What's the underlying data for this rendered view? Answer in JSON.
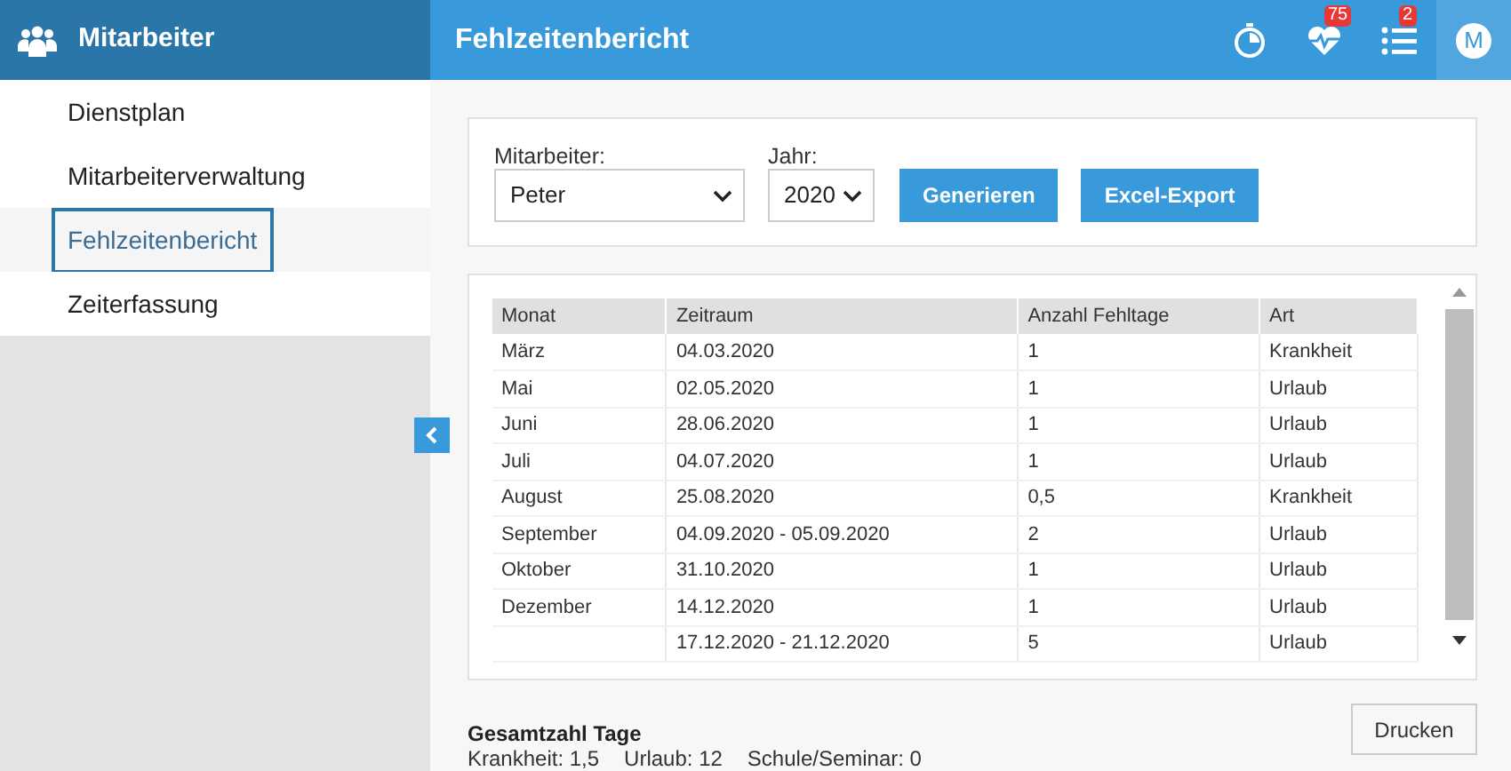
{
  "sidebar": {
    "title": "Mitarbeiter",
    "items": [
      {
        "label": "Dienstplan",
        "selected": false
      },
      {
        "label": "Mitarbeiterverwaltung",
        "selected": false
      },
      {
        "label": "Fehlzeitenbericht",
        "selected": true
      },
      {
        "label": "Zeiterfassung",
        "selected": false
      }
    ]
  },
  "header": {
    "title": "Fehlzeitenbericht",
    "icons": [
      {
        "kind": "stopwatch"
      },
      {
        "kind": "heartbeat",
        "badge": "75"
      },
      {
        "kind": "list",
        "badge": "2"
      },
      {
        "kind": "avatar",
        "initial": "M"
      }
    ]
  },
  "filters": {
    "employee": {
      "label": "Mitarbeiter:",
      "value": "Peter"
    },
    "year": {
      "label": "Jahr:",
      "value": "2020"
    },
    "buttons": [
      "Generieren",
      "Excel-Export"
    ]
  },
  "table": {
    "columns": [
      "Monat",
      "Zeitraum",
      "Anzahl Fehltage",
      "Art"
    ],
    "rows": [
      [
        "März",
        "04.03.2020",
        "1",
        "Krankheit"
      ],
      [
        "Mai",
        "02.05.2020",
        "1",
        "Urlaub"
      ],
      [
        "Juni",
        "28.06.2020",
        "1",
        "Urlaub"
      ],
      [
        "Juli",
        "04.07.2020",
        "1",
        "Urlaub"
      ],
      [
        "August",
        "25.08.2020",
        "0,5",
        "Krankheit"
      ],
      [
        "September",
        "04.09.2020 - 05.09.2020",
        "2",
        "Urlaub"
      ],
      [
        "Oktober",
        "31.10.2020",
        "1",
        "Urlaub"
      ],
      [
        "Dezember",
        "14.12.2020",
        "1",
        "Urlaub"
      ],
      [
        "",
        "17.12.2020 - 21.12.2020",
        "5",
        "Urlaub"
      ]
    ]
  },
  "summary": {
    "title": "Gesamtzahl Tage",
    "items": [
      "Krankheit: 1,5",
      "Urlaub: 12",
      "Schule/Seminar: 0"
    ]
  },
  "print_button": "Drucken"
}
